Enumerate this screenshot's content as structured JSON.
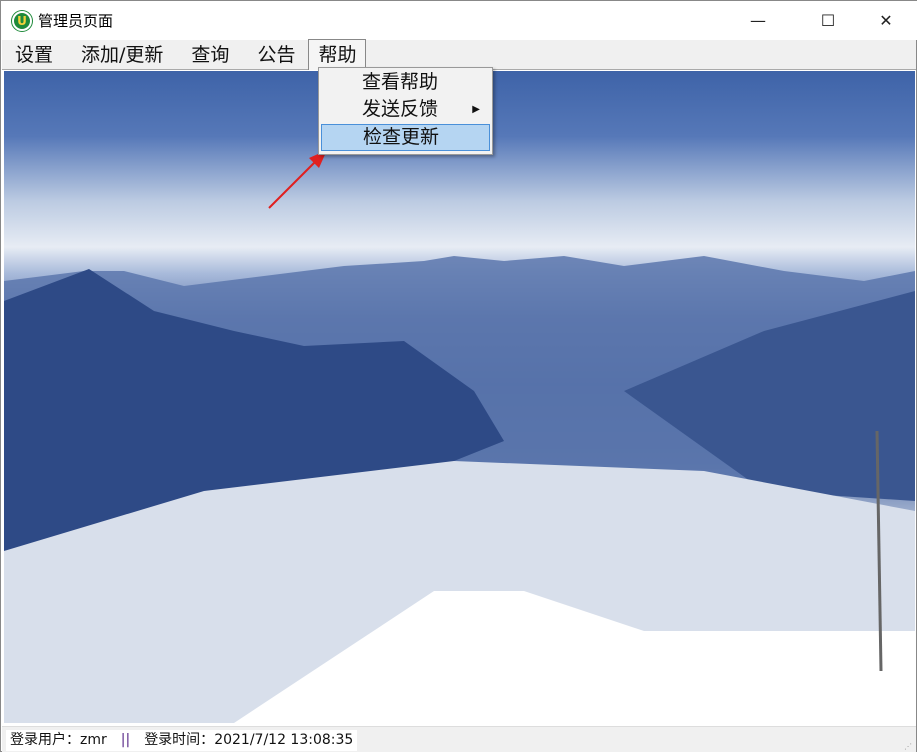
{
  "window": {
    "title": "管理员页面",
    "minimize": "—",
    "maximize": "☐",
    "close": "✕",
    "icon": "app-logo-icon"
  },
  "menubar": [
    {
      "label": "设置"
    },
    {
      "label": "添加/更新"
    },
    {
      "label": "查询"
    },
    {
      "label": "公告"
    },
    {
      "label": "帮助"
    }
  ],
  "dropdown": {
    "items": [
      {
        "label": "查看帮助"
      },
      {
        "label": "发送反馈",
        "submenu": true,
        "arrow": "▶"
      },
      {
        "label": "检查更新",
        "highlighted": true
      }
    ]
  },
  "status": {
    "user_label": "登录用户：",
    "user": "zmr",
    "separator": "||",
    "time_label": "登录时间：",
    "time": "2021/7/12 13:08:35"
  },
  "colors": {
    "highlight": "#b5d5f2",
    "highlight_border": "#4a90d9",
    "annotation_arrow": "#e02020"
  }
}
